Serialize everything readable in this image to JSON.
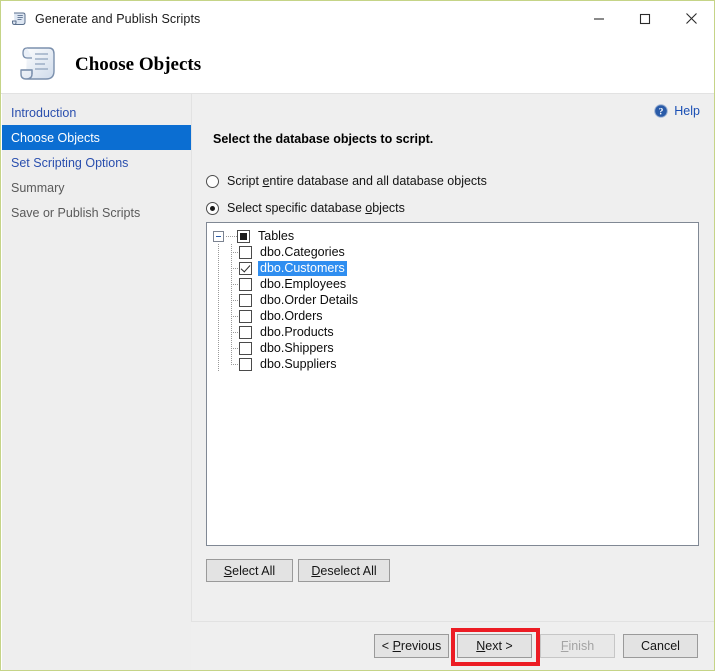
{
  "window": {
    "title": "Generate and Publish Scripts",
    "icon": "script-scroll-icon",
    "border_color": "#c5d487",
    "controls": {
      "minimize": "Minimize",
      "maximize": "Maximize",
      "close": "Close"
    }
  },
  "header": {
    "title": "Choose Objects",
    "icon": "scroll-document-icon"
  },
  "sidebar": {
    "items": [
      {
        "label": "Introduction",
        "state": "link"
      },
      {
        "label": "Choose Objects",
        "state": "active"
      },
      {
        "label": "Set Scripting Options",
        "state": "link"
      },
      {
        "label": "Summary",
        "state": "inactive"
      },
      {
        "label": "Save or Publish Scripts",
        "state": "inactive"
      }
    ],
    "active_color": "#0b6ed2",
    "link_color": "#2a4fae"
  },
  "content": {
    "help": {
      "label": "Help",
      "icon": "help-circle-icon",
      "color": "#1a4fb4"
    },
    "instruction": "Select the database objects to script.",
    "radio_options": [
      {
        "label_before": "Script ",
        "accel": "e",
        "label_after": "ntire database and all database objects",
        "checked": false
      },
      {
        "label_before": "Select specific database ",
        "accel": "o",
        "label_after": "bjects",
        "checked": true
      }
    ],
    "tree": {
      "root": {
        "label": "Tables",
        "checkbox": "filled",
        "expanded": true
      },
      "children": [
        {
          "label": "dbo.Categories",
          "checked": false,
          "selected": false
        },
        {
          "label": "dbo.Customers",
          "checked": true,
          "selected": true
        },
        {
          "label": "dbo.Employees",
          "checked": false,
          "selected": false
        },
        {
          "label": "dbo.Order Details",
          "checked": false,
          "selected": false
        },
        {
          "label": "dbo.Orders",
          "checked": false,
          "selected": false
        },
        {
          "label": "dbo.Products",
          "checked": false,
          "selected": false
        },
        {
          "label": "dbo.Shippers",
          "checked": false,
          "selected": false
        },
        {
          "label": "dbo.Suppliers",
          "checked": false,
          "selected": false
        }
      ],
      "selection_color": "#2f8ef0"
    },
    "select_buttons": {
      "select_all": {
        "before": "",
        "accel": "S",
        "after": "elect All"
      },
      "deselect_all": {
        "before": "",
        "accel": "D",
        "after": "eselect All"
      }
    }
  },
  "footer": {
    "buttons": [
      {
        "name": "previous",
        "before": "< ",
        "accel": "P",
        "after": "revious",
        "disabled": false,
        "highlighted": false
      },
      {
        "name": "next",
        "before": "",
        "accel": "N",
        "after": "ext >",
        "disabled": false,
        "highlighted": true
      },
      {
        "name": "finish",
        "before": "",
        "accel": "F",
        "after": "inish",
        "disabled": true,
        "highlighted": false
      },
      {
        "name": "cancel",
        "before": "Cancel",
        "accel": "",
        "after": "",
        "disabled": false,
        "highlighted": false
      }
    ],
    "highlight_color": "#ec1c24"
  }
}
